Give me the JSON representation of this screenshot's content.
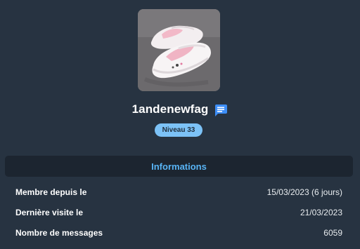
{
  "profile": {
    "username": "1andenewfag",
    "level_label": "Niveau 33",
    "icons": {
      "message": "message-icon",
      "avatar": "avatar-image"
    },
    "colors": {
      "accent": "#58b4f5",
      "badge": "#7cc2f6",
      "message_icon": "#3d8ef7"
    }
  },
  "info": {
    "title": "Informations",
    "rows": [
      {
        "label": "Membre depuis le",
        "value": "15/03/2023 (6 jours)"
      },
      {
        "label": "Dernière visite le",
        "value": "21/03/2023"
      },
      {
        "label": "Nombre de messages",
        "value": "6059"
      }
    ]
  }
}
